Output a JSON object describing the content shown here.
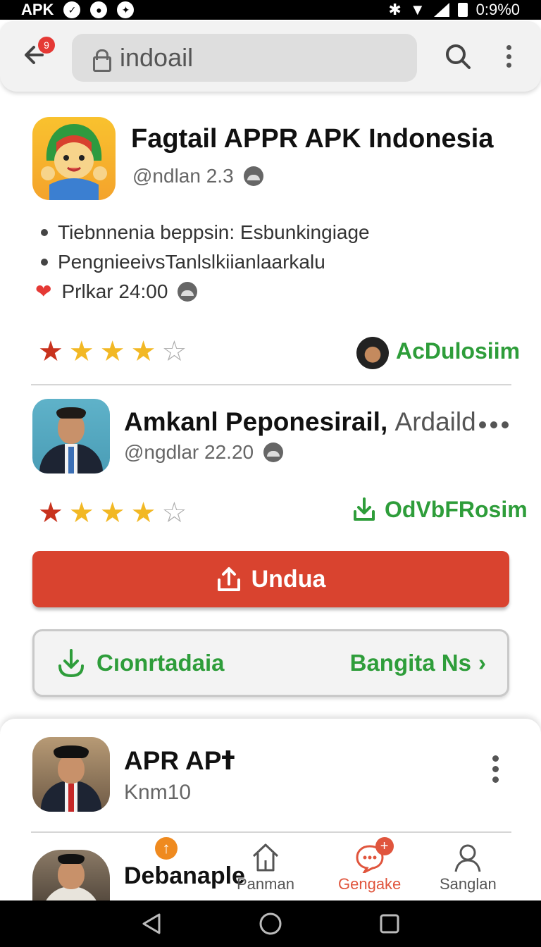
{
  "status_bar": {
    "app_label": "APK",
    "time": "0:9%0"
  },
  "toolbar": {
    "back_badge": "9",
    "search_value": "indoail"
  },
  "colors": {
    "primary_red": "#d9432f",
    "accent_green": "#2e9d3a",
    "accent_orange": "#ef8a1f"
  },
  "cards": [
    {
      "title": "Fagtail APPR APK Indonesia",
      "subtitle": "@ndlan 2.3",
      "bullets": [
        "Tiebnnenia beppsin: Esbunkingiage",
        "PengnieeivsTanlslkiianlaarkalu"
      ],
      "meta": "Prlkar 24:00",
      "rating": 4,
      "action": "AcDulosiim"
    },
    {
      "title": "Amkanl Peponesirail,",
      "title_suffix": "Ardaild",
      "subtitle": "@ngdlar 22.20",
      "rating": 4,
      "action": "OdVbFRosim"
    },
    {
      "title": "APR APߙ",
      "subtitle": "Knm10"
    }
  ],
  "buttons": {
    "primary_label": "Undua",
    "secondary_left": "Cıonrtadaia",
    "secondary_right": "Bangita Ns"
  },
  "partial_card": {
    "title": "Debanaple"
  },
  "bottom_nav": [
    {
      "label": "Panman",
      "icon": "home-icon"
    },
    {
      "label": "Gengake",
      "icon": "chat-icon",
      "badge": "+"
    },
    {
      "label": "Sanglan",
      "icon": "user-icon"
    }
  ]
}
